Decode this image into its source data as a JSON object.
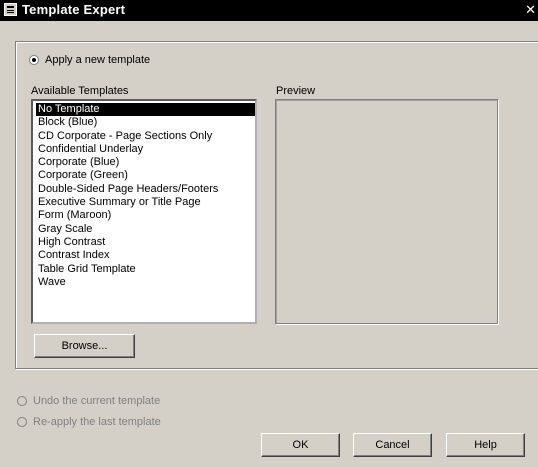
{
  "window": {
    "title": "Template Expert",
    "close_label": "✕"
  },
  "apply_new": {
    "label": "Apply a new template",
    "checked": true
  },
  "available_label": "Available Templates",
  "preview_label": "Preview",
  "templates": [
    "No Template",
    "Block (Blue)",
    "CD Corporate - Page Sections Only",
    "Confidential Underlay",
    "Corporate (Blue)",
    "Corporate (Green)",
    "Double-Sided Page Headers/Footers",
    "Executive Summary or Title Page",
    "Form (Maroon)",
    "Gray Scale",
    "High Contrast",
    "Contrast Index",
    "Table Grid Template",
    "Wave"
  ],
  "selected_template": "No Template",
  "browse_label": "Browse...",
  "undo": {
    "label": "Undo the current template",
    "enabled": false
  },
  "reapply": {
    "label": "Re-apply the last template",
    "enabled": false
  },
  "buttons": {
    "ok": "OK",
    "cancel": "Cancel",
    "help": "Help"
  }
}
